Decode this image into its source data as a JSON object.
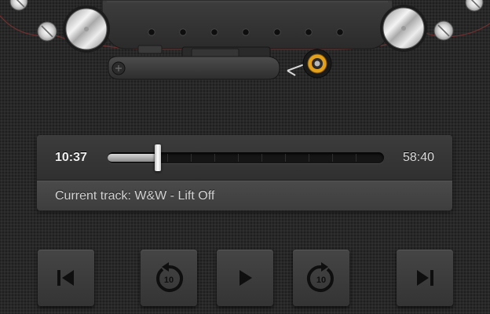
{
  "player": {
    "elapsed": "10:37",
    "total": "58:40",
    "progress_fraction": 0.181,
    "current_track_label": "Current track: W&W - Lift Off",
    "skip_seconds": "10"
  },
  "controls": [
    {
      "name": "previous-track-button",
      "icon": "skip-previous-icon"
    },
    {
      "name": "rewind-10-button",
      "icon": "rewind-10-icon"
    },
    {
      "name": "play-button",
      "icon": "play-icon"
    },
    {
      "name": "forward-10-button",
      "icon": "forward-10-icon"
    },
    {
      "name": "next-track-button",
      "icon": "skip-next-icon"
    }
  ],
  "colors": {
    "background": "#282828",
    "panel": "#3a3a3a",
    "text": "#f0f0f0",
    "pinch_roller_accent": "#e2a01c",
    "icon": "#0f0f0f"
  }
}
